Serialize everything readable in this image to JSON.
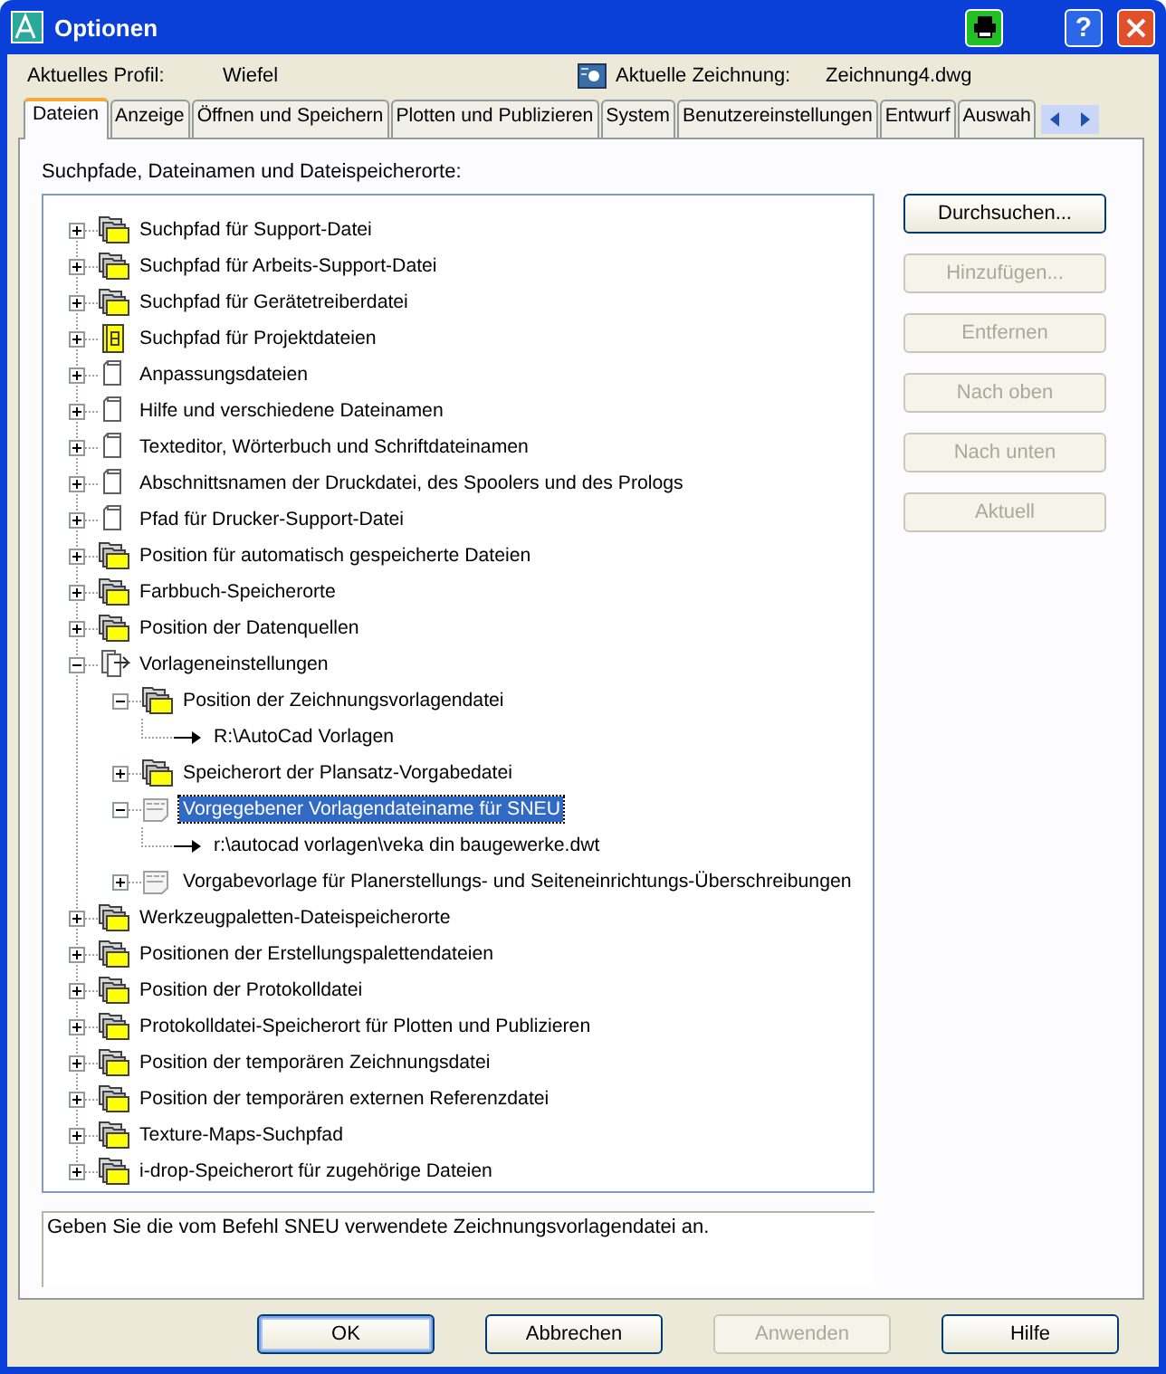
{
  "window": {
    "title": "Optionen",
    "help_button": "?"
  },
  "profile": {
    "label": "Aktuelles Profil:",
    "value": "Wiefel",
    "drawing_label": "Aktuelle Zeichnung:",
    "drawing_value": "Zeichnung4.dwg"
  },
  "tabs": [
    {
      "label": "Dateien",
      "selected": true
    },
    {
      "label": "Anzeige",
      "selected": false
    },
    {
      "label": "Öffnen und Speichern",
      "selected": false
    },
    {
      "label": "Plotten und Publizieren",
      "selected": false
    },
    {
      "label": "System",
      "selected": false
    },
    {
      "label": "Benutzereinstellungen",
      "selected": false
    },
    {
      "label": "Entwurf",
      "selected": false
    },
    {
      "label": "Auswah",
      "selected": false
    }
  ],
  "tree_label": "Suchpfade, Dateinamen und Dateispeicherorte:",
  "tree": [
    {
      "label": "Suchpfad für Support-Datei",
      "kind": "folders",
      "expanded": false,
      "selected": false
    },
    {
      "label": "Suchpfad für Arbeits-Support-Datei",
      "kind": "folders",
      "expanded": false,
      "selected": false
    },
    {
      "label": "Suchpfad für Gerätetreiberdatei",
      "kind": "folders",
      "expanded": false,
      "selected": false
    },
    {
      "label": "Suchpfad für Projektdateien",
      "kind": "project",
      "expanded": false,
      "selected": false
    },
    {
      "label": "Anpassungsdateien",
      "kind": "file",
      "expanded": false,
      "selected": false
    },
    {
      "label": "Hilfe und verschiedene Dateinamen",
      "kind": "file",
      "expanded": false,
      "selected": false
    },
    {
      "label": "Texteditor, Wörterbuch und Schriftdateinamen",
      "kind": "file",
      "expanded": false,
      "selected": false
    },
    {
      "label": "Abschnittsnamen der Druckdatei, des Spoolers und des Prologs",
      "kind": "file",
      "expanded": false,
      "selected": false
    },
    {
      "label": "Pfad für Drucker-Support-Datei",
      "kind": "file",
      "expanded": false,
      "selected": false
    },
    {
      "label": "Position für automatisch gespeicherte Dateien",
      "kind": "folders",
      "expanded": false,
      "selected": false
    },
    {
      "label": "Farbbuch-Speicherorte",
      "kind": "folders",
      "expanded": false,
      "selected": false
    },
    {
      "label": "Position der Datenquellen",
      "kind": "folders",
      "expanded": false,
      "selected": false
    },
    {
      "label": "Vorlageneinstellungen",
      "kind": "files",
      "expanded": true,
      "selected": false,
      "children": [
        {
          "label": "Position der Zeichnungsvorlagendatei",
          "kind": "folders",
          "expanded": true,
          "selected": false,
          "children": [
            {
              "label": "R:\\AutoCad Vorlagen",
              "kind": "path",
              "selected": false
            }
          ]
        },
        {
          "label": "Speicherort der Plansatz-Vorgabedatei",
          "kind": "folders",
          "expanded": false,
          "selected": false
        },
        {
          "label": "Vorgegebener Vorlagendateiname für SNEU",
          "kind": "template",
          "expanded": true,
          "selected": true,
          "children": [
            {
              "label": "r:\\autocad vorlagen\\veka din baugewerke.dwt",
              "kind": "path",
              "selected": false
            }
          ]
        },
        {
          "label": "Vorgabevorlage für Planerstellungs- und Seiteneinrichtungs-Überschreibungen",
          "kind": "template",
          "expanded": false,
          "selected": false
        }
      ]
    },
    {
      "label": "Werkzeugpaletten-Dateispeicherorte",
      "kind": "folders",
      "expanded": false,
      "selected": false
    },
    {
      "label": "Positionen der Erstellungspalettendateien",
      "kind": "folders",
      "expanded": false,
      "selected": false
    },
    {
      "label": "Position der Protokolldatei",
      "kind": "folders",
      "expanded": false,
      "selected": false
    },
    {
      "label": "Protokolldatei-Speicherort für Plotten und Publizieren",
      "kind": "folders",
      "expanded": false,
      "selected": false
    },
    {
      "label": "Position der temporären Zeichnungsdatei",
      "kind": "folders",
      "expanded": false,
      "selected": false
    },
    {
      "label": "Position der temporären externen Referenzdatei",
      "kind": "folders",
      "expanded": false,
      "selected": false
    },
    {
      "label": "Texture-Maps-Suchpfad",
      "kind": "folders",
      "expanded": false,
      "selected": false
    },
    {
      "label": "i-drop-Speicherort für zugehörige Dateien",
      "kind": "folders",
      "expanded": false,
      "selected": false
    }
  ],
  "side_buttons": [
    {
      "label": "Durchsuchen...",
      "disabled": false
    },
    {
      "label": "Hinzufügen...",
      "disabled": true
    },
    {
      "label": "Entfernen",
      "disabled": true
    },
    {
      "label": "Nach oben",
      "disabled": true
    },
    {
      "label": "Nach unten",
      "disabled": true
    },
    {
      "label": "Aktuell",
      "disabled": true
    }
  ],
  "description": "Geben Sie die vom Befehl SNEU verwendete Zeichnungsvorlagendatei an.",
  "buttons": [
    {
      "label": "OK",
      "disabled": false,
      "default": true
    },
    {
      "label": "Abbrechen",
      "disabled": false,
      "default": false
    },
    {
      "label": "Anwenden",
      "disabled": true,
      "default": false
    },
    {
      "label": "Hilfe",
      "disabled": false,
      "default": false
    }
  ]
}
